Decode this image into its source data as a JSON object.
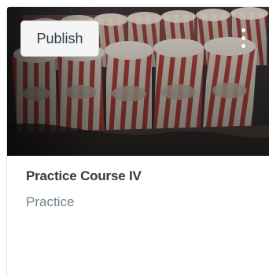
{
  "card": {
    "publish_label": "Publish",
    "title": "Practice Course IV",
    "subtitle": "Practice",
    "image_icon": "popcorn-boxes-image",
    "menu_icon": "more-options-vertical-icon"
  },
  "colors": {
    "title": "#2d3b45",
    "subtitle": "#73818c",
    "button_bg": "#f5f5f5",
    "popcorn_red": "#b8473f",
    "popcorn_cream": "#e9ded0"
  }
}
